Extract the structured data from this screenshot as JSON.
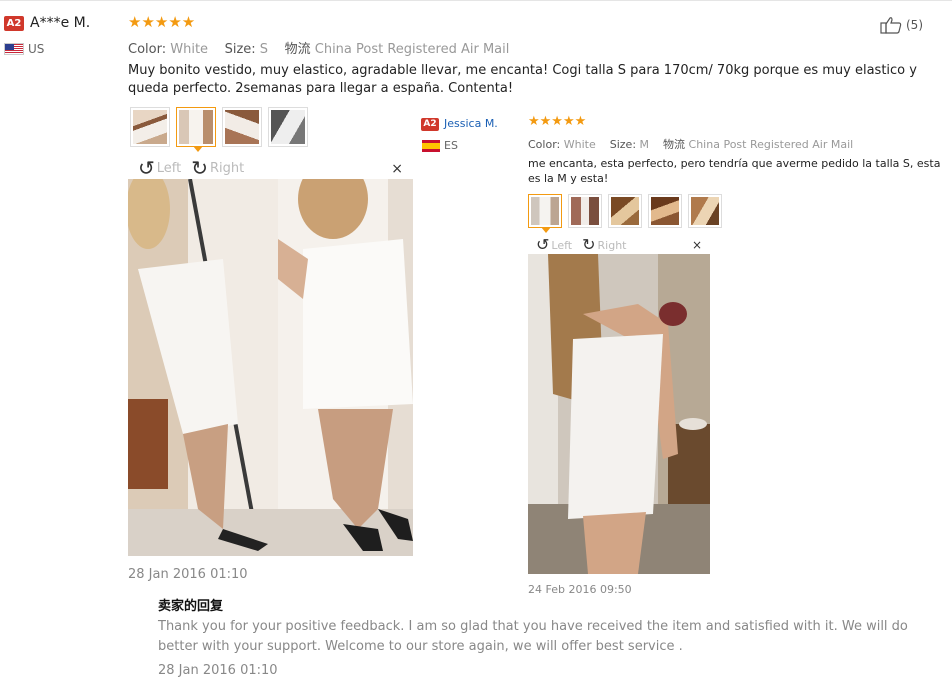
{
  "review1": {
    "badge": "A2",
    "user": "A***e M.",
    "country": "US",
    "stars": "★★★★★",
    "color_label": "Color:",
    "color_value": "White",
    "size_label": "Size:",
    "size_value": "S",
    "ship_label": "物流",
    "ship_value": "China Post Registered Air Mail",
    "text": "Muy bonito vestido, muy elastico, agradable llevar, me encanta! Cogi talla S para 170cm/ 70kg porque es muy elastico y queda perfecto. 2semanas para llegar a españa. Contenta!",
    "likes": "(5)",
    "rotate_left": "Left",
    "rotate_right": "Right",
    "close": "×",
    "date": "28 Jan 2016 01:10"
  },
  "reply": {
    "title": "卖家的回复",
    "text": "Thank you for your positive feedback. I am so glad that you have received the item and satisfied with it. We will do better with your support. Welcome to our store again, we will offer best service .",
    "date": "28 Jan 2016 01:10"
  },
  "review2": {
    "badge": "A2",
    "user": "Jessica M.",
    "country": "ES",
    "stars": "★★★★★",
    "color_label": "Color:",
    "color_value": "White",
    "size_label": "Size:",
    "size_value": "M",
    "ship_label": "物流",
    "ship_value": "China Post Registered Air Mail",
    "text": "me encanta, esta perfecto, pero tendría que averme pedido la talla S, esta es la M y esta!",
    "rotate_left": "Left",
    "rotate_right": "Right",
    "close": "×",
    "date": "24 Feb 2016 09:50"
  },
  "colors": {
    "accent": "#f39a11",
    "badge": "#d0382b",
    "link": "#1a5fb4"
  }
}
